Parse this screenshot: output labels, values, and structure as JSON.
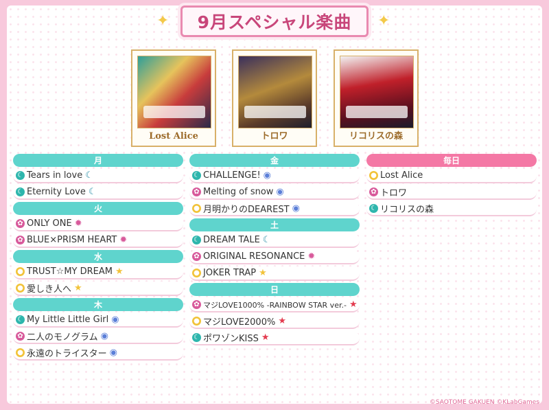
{
  "title": "9月スペシャル楽曲",
  "jackets": [
    {
      "label": "Lost Alice"
    },
    {
      "label": "トロワ"
    },
    {
      "label": "リコリスの森"
    }
  ],
  "columns": [
    {
      "groups": [
        {
          "day": "月",
          "songs": [
            {
              "title": "Tears in love",
              "attr": "cool",
              "tag": "moon"
            },
            {
              "title": "Eternity Love",
              "attr": "cool",
              "tag": "moon"
            }
          ]
        },
        {
          "day": "火",
          "songs": [
            {
              "title": "ONLY ONE",
              "attr": "sweet",
              "tag": "gear"
            },
            {
              "title": "BLUE×PRISM HEART",
              "attr": "sweet",
              "tag": "gear"
            }
          ]
        },
        {
          "day": "水",
          "songs": [
            {
              "title": "TRUST☆MY DREAM",
              "attr": "fun",
              "tag": "star"
            },
            {
              "title": "愛しき人へ",
              "attr": "fun",
              "tag": "star"
            }
          ]
        },
        {
          "day": "木",
          "songs": [
            {
              "title": "My Little Little Girl",
              "attr": "cool",
              "tag": "orb"
            },
            {
              "title": "二人のモノグラム",
              "attr": "sweet",
              "tag": "orb"
            },
            {
              "title": "永遠のトライスター",
              "attr": "fun",
              "tag": "orb"
            }
          ]
        }
      ]
    },
    {
      "groups": [
        {
          "day": "金",
          "songs": [
            {
              "title": "CHALLENGE!",
              "attr": "cool",
              "tag": "orb"
            },
            {
              "title": "Melting of snow",
              "attr": "sweet",
              "tag": "orb"
            },
            {
              "title": "月明かりのDEAREST",
              "attr": "fun",
              "tag": "orb"
            }
          ]
        },
        {
          "day": "土",
          "songs": [
            {
              "title": "DREAM TALE",
              "attr": "cool",
              "tag": "moon"
            },
            {
              "title": "ORIGINAL RESONANCE",
              "attr": "sweet",
              "tag": "gear"
            },
            {
              "title": "JOKER TRAP",
              "attr": "fun",
              "tag": "star"
            }
          ]
        },
        {
          "day": "日",
          "songs": [
            {
              "title": "マジLOVE1000% -RAINBOW STAR ver.-",
              "attr": "sweet",
              "tag": "redstar",
              "small": true
            },
            {
              "title": "マジLOVE2000%",
              "attr": "fun",
              "tag": "redstar"
            },
            {
              "title": "ポワゾンKISS",
              "attr": "cool",
              "tag": "redstar"
            }
          ]
        }
      ]
    },
    {
      "groups": [
        {
          "day": "毎日",
          "daily": true,
          "songs": [
            {
              "title": "Lost Alice",
              "attr": "fun",
              "tag": ""
            },
            {
              "title": "トロワ",
              "attr": "sweet",
              "tag": ""
            },
            {
              "title": "リコリスの森",
              "attr": "cool",
              "tag": ""
            }
          ]
        }
      ]
    }
  ],
  "copyright": "©SAOTOME GAKUEN ©KLabGames",
  "colors": {
    "day_bar": "#5fd4cd",
    "daily_bar": "#f478a5",
    "title": "#c8467a"
  }
}
